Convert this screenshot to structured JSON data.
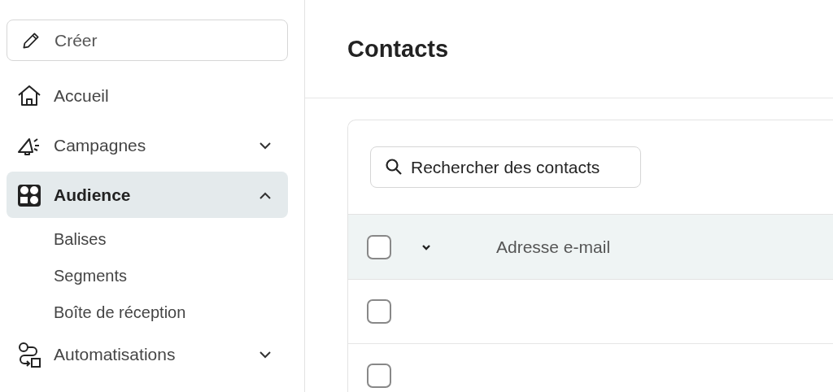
{
  "sidebar": {
    "create_button": {
      "label": "Créer"
    },
    "items": [
      {
        "label": "Accueil",
        "selected": false
      },
      {
        "label": "Campagnes",
        "selected": false,
        "expanded": false
      },
      {
        "label": "Audience",
        "selected": true,
        "expanded": true,
        "children": [
          {
            "label": "Balises"
          },
          {
            "label": "Segments"
          },
          {
            "label": "Boîte de réception"
          }
        ]
      },
      {
        "label": "Automatisations",
        "selected": false,
        "expanded": false
      }
    ]
  },
  "page": {
    "title": "Contacts"
  },
  "search": {
    "placeholder": "Rechercher des contacts"
  },
  "table": {
    "header": {
      "checked": false,
      "column_2": "Adresse e-mail"
    },
    "rows": [
      {
        "checked": false
      },
      {
        "checked": false
      }
    ]
  }
}
